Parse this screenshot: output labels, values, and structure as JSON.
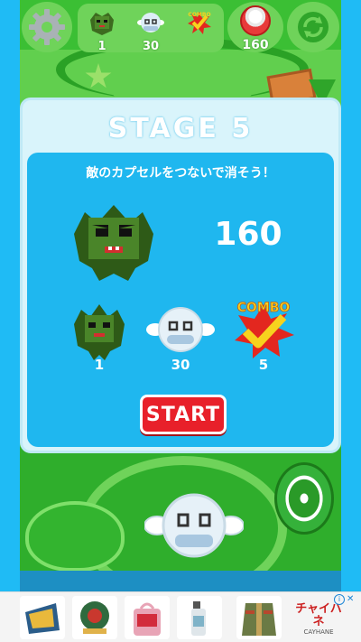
{
  "topbar": {
    "counters": [
      {
        "icon": "goblin-icon",
        "value": "1"
      },
      {
        "icon": "ghost-icon",
        "value": "30"
      },
      {
        "icon": "combo-icon",
        "value": "",
        "badge": "COMBO"
      }
    ],
    "ball_count": "160"
  },
  "stage": {
    "title": "STAGE 5",
    "mission": "敵のカプセルをつないで消そう！",
    "target_count": "160",
    "requirements": [
      {
        "icon": "goblin-icon",
        "value": "1"
      },
      {
        "icon": "ghost-icon",
        "value": "30"
      },
      {
        "icon": "combo-icon",
        "value": "5",
        "badge": "COMBO"
      }
    ],
    "start_label": "START"
  },
  "ad": {
    "brand": "チャイハネ",
    "brand_sub": "CAYHANE"
  },
  "colors": {
    "sky": "#21b8f2",
    "board": "#3bbf34",
    "panel": "#d9f4fb",
    "panel_inner": "#1fb7ef",
    "start": "#e8202a"
  }
}
